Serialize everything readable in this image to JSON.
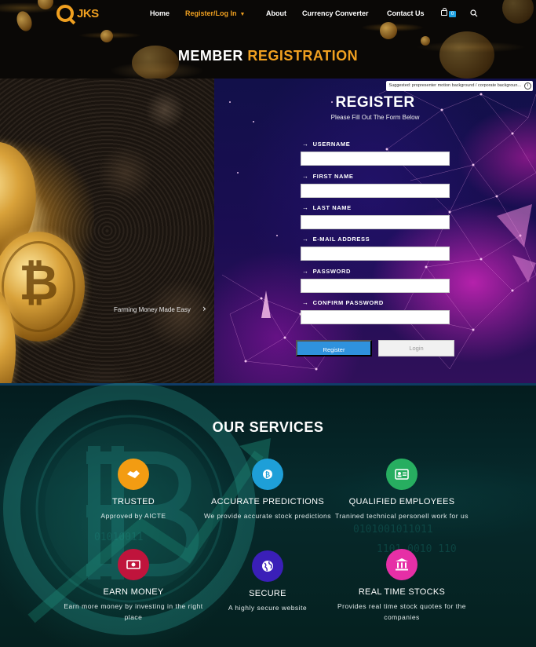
{
  "header": {
    "logo_text": "JKS",
    "nav": [
      {
        "label": "Home"
      },
      {
        "label": "Register/Log In"
      },
      {
        "label": "About"
      },
      {
        "label": "Currency Converter"
      },
      {
        "label": "Contact Us"
      }
    ],
    "cart_count": "0",
    "page_title_part1": "MEMBER",
    "page_title_part2": "REGISTRATION"
  },
  "slider": {
    "caption": "Farming Money Made Easy"
  },
  "register": {
    "suggestion_text": "Suggested: propresenter motion background / corporate backgroun...",
    "title": "REGISTER",
    "subtitle": "Please Fill Out The Form Below",
    "fields": [
      {
        "label": "USERNAME",
        "value": ""
      },
      {
        "label": "FIRST NAME",
        "value": ""
      },
      {
        "label": "LAST NAME",
        "value": ""
      },
      {
        "label": "E-MAIL ADDRESS",
        "value": ""
      },
      {
        "label": "PASSWORD",
        "value": ""
      },
      {
        "label": "CONFIRM PASSWORD",
        "value": ""
      }
    ],
    "register_button": "Register",
    "login_button": "Login"
  },
  "services": {
    "title": "OUR SERVICES",
    "items": [
      {
        "title": "TRUSTED",
        "desc": "Approved by AICTE",
        "color": "#f39c12",
        "icon": "handshake-icon"
      },
      {
        "title": "ACCURATE PREDICTIONS",
        "desc": "We provide accurate stock predictions",
        "color": "#1e9fd8",
        "icon": "bitcoin-icon"
      },
      {
        "title": "QUALIFIED EMPLOYEES",
        "desc": "Tranined technical personell work for us",
        "color": "#27ae60",
        "icon": "id-card-icon"
      },
      {
        "title": "EARN MONEY",
        "desc": "Earn more money by investing in the right place",
        "color": "#c0143c",
        "icon": "money-icon"
      },
      {
        "title": "SECURE",
        "desc": "A highly secure website",
        "color": "#3a1fb8",
        "icon": "globe-icon"
      },
      {
        "title": "REAL TIME STOCKS",
        "desc": "Provides real time stock quotes for the companies",
        "color": "#e62fa6",
        "icon": "bank-icon"
      }
    ]
  },
  "colors": {
    "accent": "#f0a020",
    "register_button": "#2f92dd"
  }
}
